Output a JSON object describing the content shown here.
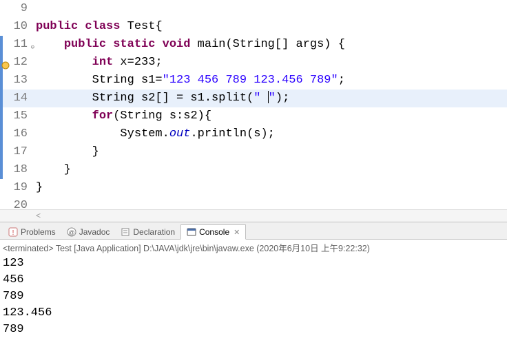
{
  "editor": {
    "lines": [
      {
        "num": "9",
        "markers": [],
        "tokens": []
      },
      {
        "num": "10",
        "markers": [],
        "tokens": [
          {
            "cls": "kw",
            "t": "public"
          },
          {
            "cls": "plain",
            "t": " "
          },
          {
            "cls": "kw",
            "t": "class"
          },
          {
            "cls": "plain",
            "t": " Test{"
          }
        ]
      },
      {
        "num": "11",
        "markers": [
          "blue",
          "collapse"
        ],
        "tokens": [
          {
            "cls": "plain",
            "t": "    "
          },
          {
            "cls": "kw",
            "t": "public"
          },
          {
            "cls": "plain",
            "t": " "
          },
          {
            "cls": "kw",
            "t": "static"
          },
          {
            "cls": "plain",
            "t": " "
          },
          {
            "cls": "kw",
            "t": "void"
          },
          {
            "cls": "plain",
            "t": " main(String[] args) {"
          }
        ]
      },
      {
        "num": "12",
        "markers": [
          "blue",
          "warn"
        ],
        "tokens": [
          {
            "cls": "plain",
            "t": "        "
          },
          {
            "cls": "kw",
            "t": "int"
          },
          {
            "cls": "plain",
            "t": " x=233;"
          }
        ]
      },
      {
        "num": "13",
        "markers": [
          "blue"
        ],
        "tokens": [
          {
            "cls": "plain",
            "t": "        String s1="
          },
          {
            "cls": "str",
            "t": "\"123 456 789 123.456 789\""
          },
          {
            "cls": "plain",
            "t": ";"
          }
        ]
      },
      {
        "num": "14",
        "markers": [
          "blue"
        ],
        "highlighted": true,
        "hasCaret": true,
        "tokens": [
          {
            "cls": "plain",
            "t": "        String s2[] = s1.split("
          },
          {
            "cls": "str",
            "t": "\" "
          },
          {
            "caret": true
          },
          {
            "cls": "str",
            "t": "\""
          },
          {
            "cls": "plain",
            "t": ");"
          }
        ]
      },
      {
        "num": "15",
        "markers": [
          "blue"
        ],
        "tokens": [
          {
            "cls": "plain",
            "t": "        "
          },
          {
            "cls": "kw",
            "t": "for"
          },
          {
            "cls": "plain",
            "t": "(String s:s2){"
          }
        ]
      },
      {
        "num": "16",
        "markers": [
          "blue"
        ],
        "tokens": [
          {
            "cls": "plain",
            "t": "            System."
          },
          {
            "cls": "static-field",
            "t": "out"
          },
          {
            "cls": "plain",
            "t": ".println(s);"
          }
        ]
      },
      {
        "num": "17",
        "markers": [
          "blue"
        ],
        "tokens": [
          {
            "cls": "plain",
            "t": "        }"
          }
        ]
      },
      {
        "num": "18",
        "markers": [
          "blue"
        ],
        "tokens": [
          {
            "cls": "plain",
            "t": "    }"
          }
        ]
      },
      {
        "num": "19",
        "markers": [],
        "tokens": [
          {
            "cls": "plain",
            "t": "}"
          }
        ]
      },
      {
        "num": "20",
        "markers": [],
        "truncated": true,
        "tokens": []
      }
    ]
  },
  "tabs": {
    "items": [
      {
        "id": "problems",
        "label": "Problems",
        "icon": "problems-icon",
        "active": false
      },
      {
        "id": "javadoc",
        "label": "Javadoc",
        "icon": "javadoc-icon",
        "active": false
      },
      {
        "id": "decl",
        "label": "Declaration",
        "icon": "declaration-icon",
        "active": false
      },
      {
        "id": "console",
        "label": "Console",
        "icon": "console-icon",
        "active": true
      }
    ]
  },
  "console": {
    "header": "<terminated> Test [Java Application] D:\\JAVA\\jdk\\jre\\bin\\javaw.exe (2020年6月10日 上午9:22:32)",
    "output": [
      "123",
      "456",
      "789",
      "123.456",
      "789"
    ]
  }
}
